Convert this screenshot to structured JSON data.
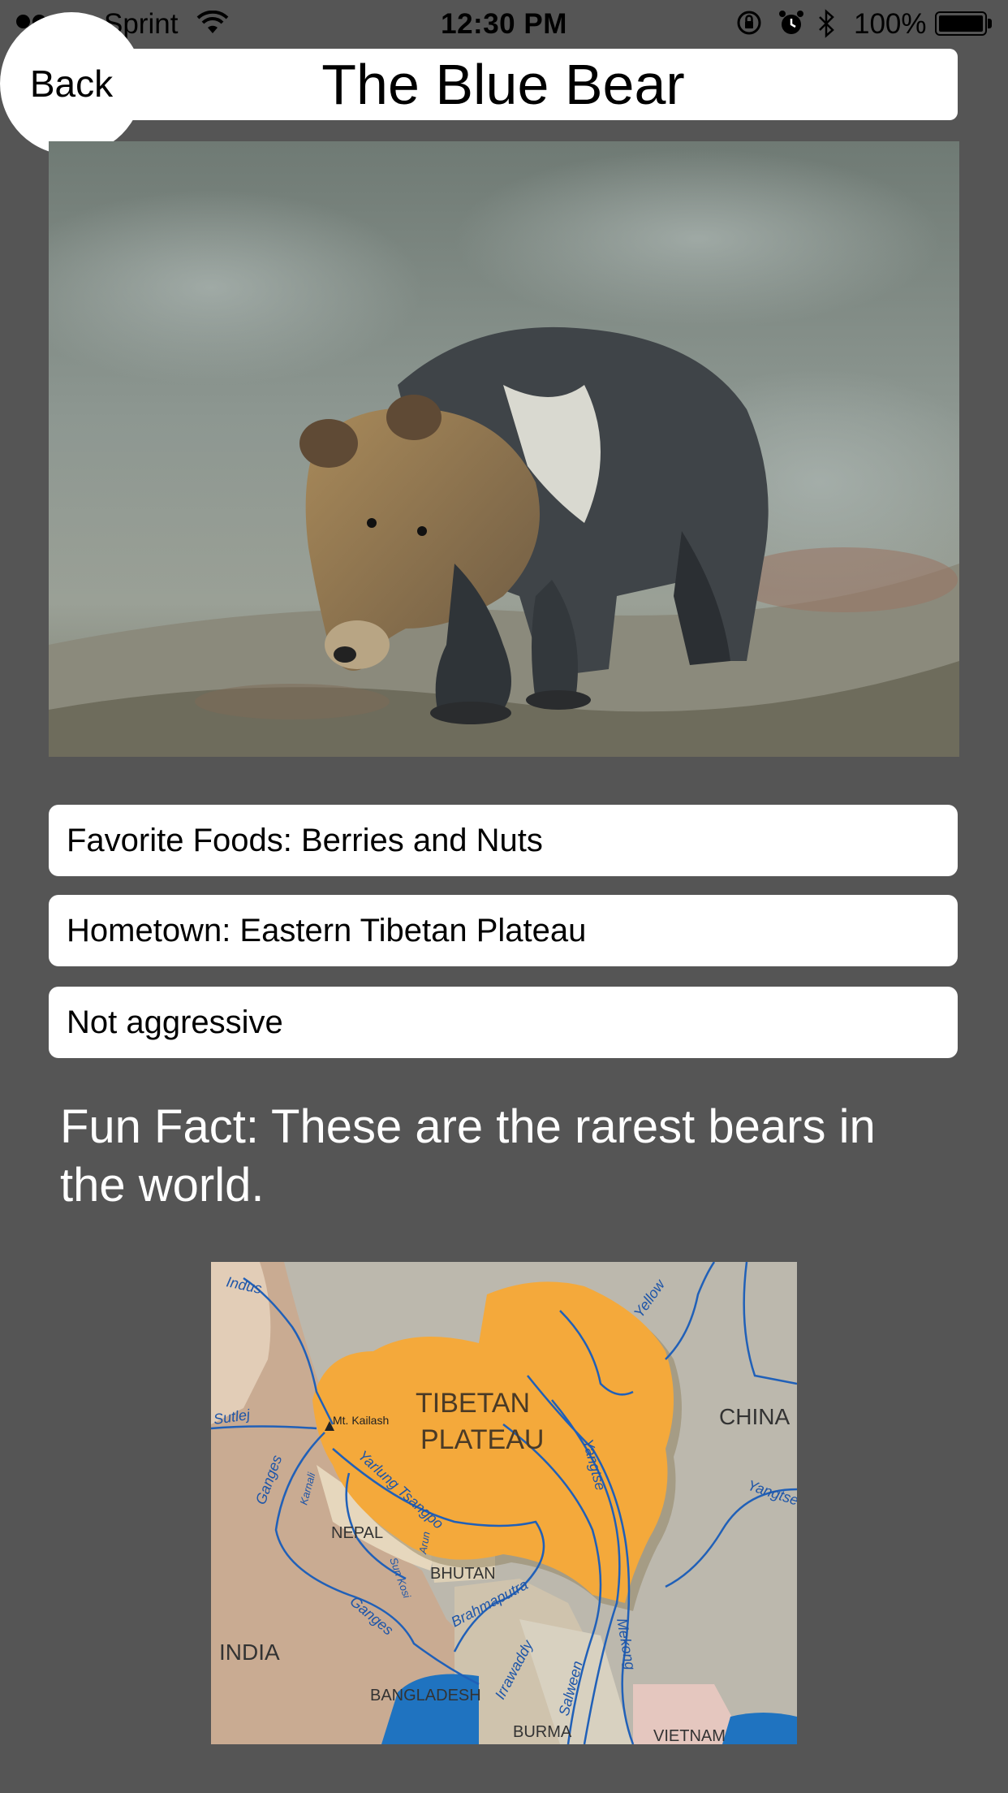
{
  "status_bar": {
    "carrier": "Sprint",
    "time": "12:30 PM",
    "battery_percent": "100%",
    "signal_bars": 4,
    "signal_bars_total": 5,
    "icons": [
      "wifi-icon",
      "orientation-lock-icon",
      "alarm-icon",
      "bluetooth-icon",
      "battery-icon"
    ]
  },
  "header": {
    "title": "The Blue Bear",
    "back_label": "Back"
  },
  "info": {
    "foods": "Favorite Foods: Berries and Nuts",
    "hometown": "Hometown: Eastern Tibetan Plateau",
    "temperament": "Not aggressive"
  },
  "fun_fact": "Fun Fact: These are the rarest bears in the world.",
  "map": {
    "region_title_line1": "TIBETAN",
    "region_title_line2": "PLATEAU",
    "countries": [
      "CHINA",
      "INDIA",
      "NEPAL",
      "BHUTAN",
      "BANGLADESH",
      "BURMA",
      "VIETNAM"
    ],
    "rivers": [
      "Indus",
      "Sutlej",
      "Ganges",
      "Karnali",
      "Arun",
      "Sun Kosi",
      "Yarlung Tsangpo",
      "Brahmaputra",
      "Irrawaddy",
      "Salween",
      "Mekong",
      "Yangtse",
      "Yangtse",
      "Yellow"
    ],
    "peak": "Mt. Kailash",
    "colors": {
      "plateau": "#f4a93b",
      "china": "#bcb8ad",
      "india": "#c9ab92",
      "sea": "#1f73c0",
      "river": "#2060b8"
    }
  }
}
